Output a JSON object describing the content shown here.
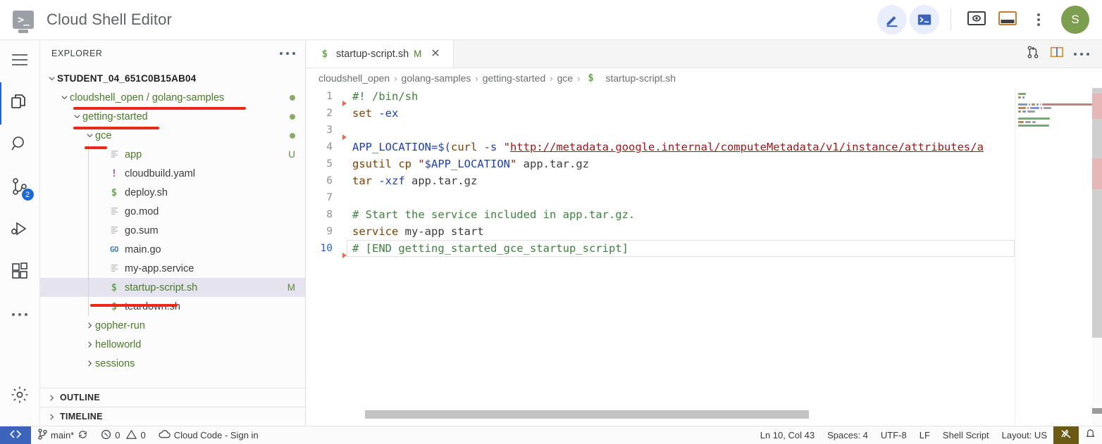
{
  "titlebar": {
    "logo_glyph": ">_",
    "title": "Cloud Shell Editor",
    "buttons": [
      {
        "name": "editor-mode-button",
        "icon": "pencil-icon"
      },
      {
        "name": "terminal-mode-button",
        "icon": "terminal-icon"
      },
      {
        "name": "web-preview-button",
        "icon": "preview-icon"
      },
      {
        "name": "open-terminal-panel-button",
        "icon": "panel-icon"
      },
      {
        "name": "more-options-button",
        "icon": "kebab-menu-icon"
      }
    ],
    "avatar_initial": "S",
    "avatar_color": "#7d9e4f"
  },
  "activitybar": {
    "items": [
      {
        "name": "menu-button",
        "icon": "hamburger-icon",
        "badge": "",
        "active": false
      },
      {
        "name": "explorer-button",
        "icon": "files-icon",
        "badge": "",
        "active": true
      },
      {
        "name": "search-button",
        "icon": "search-icon",
        "badge": "",
        "active": false
      },
      {
        "name": "source-control-button",
        "icon": "source-control-icon",
        "badge": "2",
        "active": false
      },
      {
        "name": "run-debug-button",
        "icon": "run-debug-icon",
        "badge": "",
        "active": false
      },
      {
        "name": "extensions-button",
        "icon": "extensions-icon",
        "badge": "",
        "active": false
      },
      {
        "name": "additional-views-button",
        "icon": "ellipsis-icon",
        "badge": "",
        "active": false
      }
    ],
    "settings": {
      "name": "settings-button",
      "icon": "gear-icon"
    }
  },
  "sidebar": {
    "header": "EXPLORER",
    "tree": [
      {
        "label": "STUDENT_04_651C0B15AB04",
        "type": "root",
        "indent": 0,
        "chevron": "down",
        "icon": "",
        "deco": "",
        "selected": false,
        "annotated": false
      },
      {
        "label": "cloudshell_open / golang-samples",
        "type": "folder",
        "indent": 1,
        "chevron": "down",
        "icon": "",
        "deco": "dot",
        "selected": false,
        "annotated": true
      },
      {
        "label": "getting-started",
        "type": "folder",
        "indent": 2,
        "chevron": "down",
        "icon": "",
        "deco": "dot",
        "selected": false,
        "annotated": true
      },
      {
        "label": "gce",
        "type": "folder",
        "indent": 3,
        "chevron": "down",
        "icon": "",
        "deco": "dot",
        "selected": false,
        "annotated": true
      },
      {
        "label": "app",
        "type": "file-green",
        "indent": 4,
        "chevron": "",
        "icon": "txt",
        "deco": "U",
        "selected": false,
        "annotated": false
      },
      {
        "label": "cloudbuild.yaml",
        "type": "file",
        "indent": 4,
        "chevron": "",
        "icon": "yaml",
        "deco": "",
        "selected": false,
        "annotated": false
      },
      {
        "label": "deploy.sh",
        "type": "file",
        "indent": 4,
        "chevron": "",
        "icon": "sh",
        "deco": "",
        "selected": false,
        "annotated": false
      },
      {
        "label": "go.mod",
        "type": "file",
        "indent": 4,
        "chevron": "",
        "icon": "txt",
        "deco": "",
        "selected": false,
        "annotated": false
      },
      {
        "label": "go.sum",
        "type": "file",
        "indent": 4,
        "chevron": "",
        "icon": "txt",
        "deco": "",
        "selected": false,
        "annotated": false
      },
      {
        "label": "main.go",
        "type": "file",
        "indent": 4,
        "chevron": "",
        "icon": "go",
        "deco": "",
        "selected": false,
        "annotated": false
      },
      {
        "label": "my-app.service",
        "type": "file",
        "indent": 4,
        "chevron": "",
        "icon": "txt",
        "deco": "",
        "selected": false,
        "annotated": false
      },
      {
        "label": "startup-script.sh",
        "type": "file-green",
        "indent": 4,
        "chevron": "",
        "icon": "sh",
        "deco": "M",
        "selected": true,
        "annotated": true
      },
      {
        "label": "teardown.sh",
        "type": "file",
        "indent": 4,
        "chevron": "",
        "icon": "sh",
        "deco": "",
        "selected": false,
        "annotated": false
      },
      {
        "label": "gopher-run",
        "type": "folder",
        "indent": 3,
        "chevron": "right",
        "icon": "",
        "deco": "",
        "selected": false,
        "annotated": false
      },
      {
        "label": "helloworld",
        "type": "folder",
        "indent": 3,
        "chevron": "right",
        "icon": "",
        "deco": "",
        "selected": false,
        "annotated": false
      },
      {
        "label": "sessions",
        "type": "folder",
        "indent": 3,
        "chevron": "right",
        "icon": "",
        "deco": "",
        "selected": false,
        "annotated": false
      }
    ],
    "sections": [
      {
        "label": "OUTLINE",
        "name": "outline-section"
      },
      {
        "label": "TIMELINE",
        "name": "timeline-section"
      }
    ]
  },
  "editor": {
    "tab": {
      "icon": "shell-file-icon",
      "label": "startup-script.sh",
      "modified": "M",
      "close": "✕"
    },
    "breadcrumb": [
      "cloudshell_open",
      "golang-samples",
      "getting-started",
      "gce",
      "startup-script.sh"
    ],
    "breadcrumb_file_icon": "$",
    "actions": [
      {
        "name": "open-changes-button",
        "icon": "compare-changes-icon"
      },
      {
        "name": "split-editor-button",
        "icon": "split-editor-icon"
      },
      {
        "name": "editor-more-actions-button",
        "icon": "ellipsis-icon"
      }
    ],
    "lines": [
      {
        "n": "1",
        "active": false,
        "fold": true,
        "tokens": [
          {
            "t": "#! /bin/sh",
            "c": "cmt"
          }
        ]
      },
      {
        "n": "2",
        "active": false,
        "fold": false,
        "tokens": [
          {
            "t": "set ",
            "c": "kw"
          },
          {
            "t": "-ex",
            "c": "flag"
          }
        ]
      },
      {
        "n": "3",
        "active": false,
        "fold": true,
        "tokens": []
      },
      {
        "n": "4",
        "active": false,
        "fold": false,
        "tokens": [
          {
            "t": "APP_LOCATION=",
            "c": "var"
          },
          {
            "t": "$(",
            "c": "paren"
          },
          {
            "t": "curl ",
            "c": "kw"
          },
          {
            "t": "-s ",
            "c": "flag"
          },
          {
            "t": "\"",
            "c": "str"
          },
          {
            "t": "http://metadata.google.internal/computeMetadata/v1/instance/attributes/a",
            "c": "url"
          }
        ]
      },
      {
        "n": "5",
        "active": false,
        "fold": false,
        "tokens": [
          {
            "t": "gsutil cp ",
            "c": "kw"
          },
          {
            "t": "\"",
            "c": "str"
          },
          {
            "t": "$APP_LOCATION",
            "c": "var"
          },
          {
            "t": "\" ",
            "c": "str"
          },
          {
            "t": "app.tar.gz",
            "c": "plain"
          }
        ]
      },
      {
        "n": "6",
        "active": false,
        "fold": false,
        "tokens": [
          {
            "t": "tar ",
            "c": "kw"
          },
          {
            "t": "-xzf ",
            "c": "flag"
          },
          {
            "t": "app.tar.gz",
            "c": "plain"
          }
        ]
      },
      {
        "n": "7",
        "active": false,
        "fold": false,
        "tokens": []
      },
      {
        "n": "8",
        "active": false,
        "fold": false,
        "tokens": [
          {
            "t": "# Start the service included in app.tar.gz.",
            "c": "cmt"
          }
        ]
      },
      {
        "n": "9",
        "active": false,
        "fold": false,
        "tokens": [
          {
            "t": "service ",
            "c": "kw"
          },
          {
            "t": "my-app ",
            "c": "plain"
          },
          {
            "t": "start",
            "c": "plain"
          }
        ]
      },
      {
        "n": "10",
        "active": true,
        "fold": true,
        "tokens": [
          {
            "t": "# [END getting_started_gce_startup_script]",
            "c": "cmt"
          }
        ]
      }
    ]
  },
  "statusbar": {
    "remote_icon": "remote-window-icon",
    "left": [
      {
        "name": "branch-status",
        "icon": "git-branch-icon",
        "label": "main*",
        "extra_icon": "sync-icon"
      },
      {
        "name": "problems-status",
        "icon": "error-icon",
        "label": "0",
        "icon2": "warning-icon",
        "label2": "0"
      },
      {
        "name": "cloud-code-signin-status",
        "icon": "cloud-icon",
        "label": "Cloud Code - Sign in"
      }
    ],
    "right": [
      {
        "name": "cursor-position-status",
        "label": "Ln 10, Col 43"
      },
      {
        "name": "indentation-status",
        "label": "Spaces: 4"
      },
      {
        "name": "encoding-status",
        "label": "UTF-8"
      },
      {
        "name": "eol-status",
        "label": "LF"
      },
      {
        "name": "language-mode-status",
        "label": "Shell Script"
      },
      {
        "name": "keyboard-layout-status",
        "label": "Layout: US"
      }
    ],
    "badge_icon": "screencast-off-icon",
    "bell_icon": "notifications-bell-icon",
    "badge_color": "#6b5a14"
  }
}
